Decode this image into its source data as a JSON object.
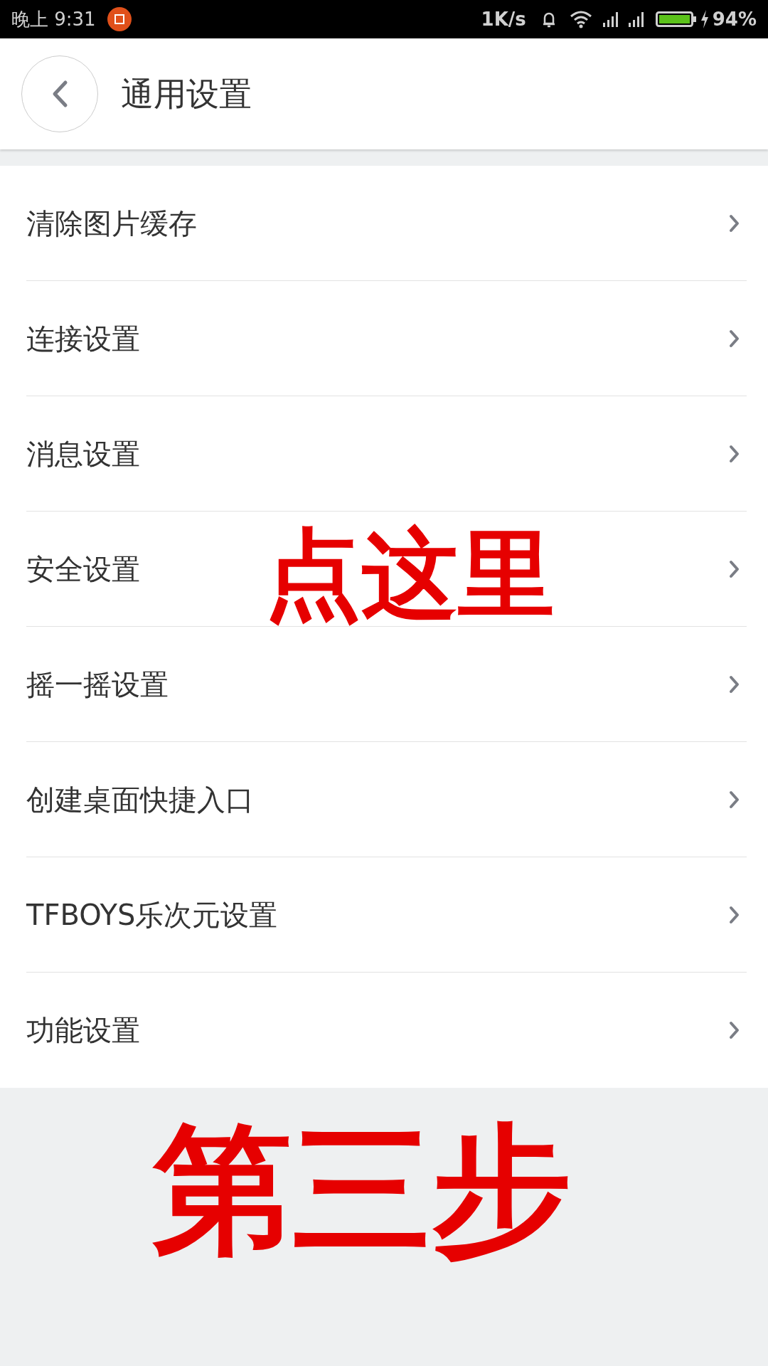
{
  "status_bar": {
    "time": "晚上 9:31",
    "speed": "1K/s",
    "battery": "94%"
  },
  "header": {
    "title": "通用设置"
  },
  "items": [
    {
      "label": "清除图片缓存"
    },
    {
      "label": "连接设置"
    },
    {
      "label": "消息设置"
    },
    {
      "label": "安全设置"
    },
    {
      "label": "摇一摇设置"
    },
    {
      "label": "创建桌面快捷入口"
    },
    {
      "label": "TFBOYS乐次元设置"
    },
    {
      "label": "功能设置"
    }
  ],
  "annotations": [
    {
      "text": "点这里"
    },
    {
      "text": "第三步"
    }
  ]
}
